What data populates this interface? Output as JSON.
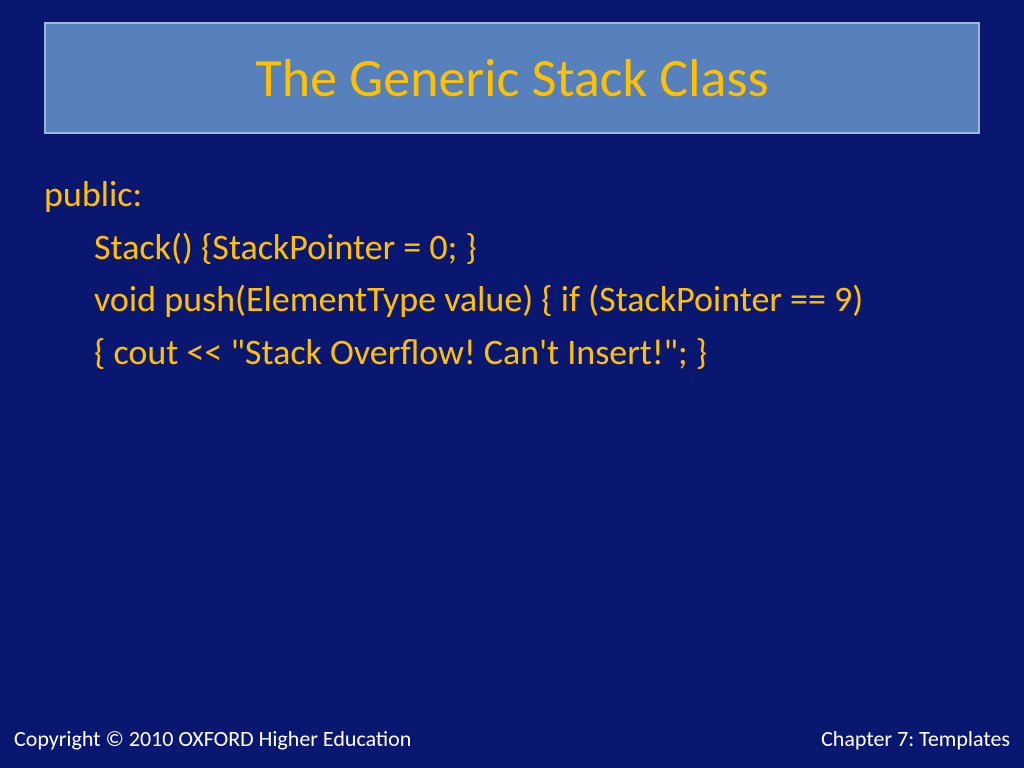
{
  "title": "The Generic Stack Class",
  "code": {
    "line1": "public:",
    "line2": "Stack() {StackPointer = 0; }",
    "line3": "void push(ElementType value) { if (StackPointer == 9)",
    "line4": "{ cout << \"Stack Overflow! Can't Insert!\";   }"
  },
  "footer": {
    "left": "Copyright © 2010 OXFORD Higher Education",
    "right": "Chapter 7: Templates"
  }
}
